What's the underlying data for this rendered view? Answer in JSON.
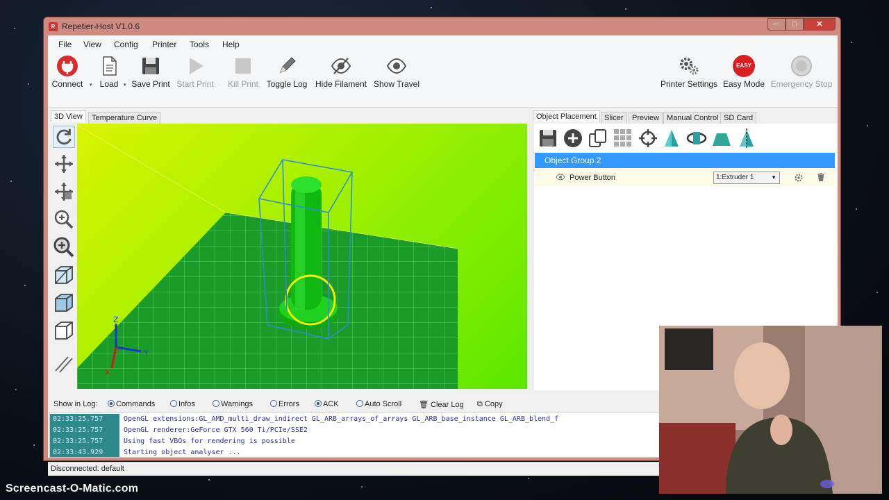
{
  "window": {
    "title": "Repetier-Host V1.0.6",
    "min_glyph": "─",
    "max_glyph": "□",
    "close_glyph": "✕",
    "icon_letter": "R"
  },
  "menu": [
    "File",
    "View",
    "Config",
    "Printer",
    "Tools",
    "Help"
  ],
  "toolbar": {
    "connect": "Connect",
    "load": "Load",
    "save_print": "Save Print",
    "start_print": "Start Print",
    "kill_print": "Kill Print",
    "toggle_log": "Toggle Log",
    "hide_filament": "Hide Filament",
    "show_travel": "Show Travel",
    "printer_settings": "Printer Settings",
    "easy_mode": "Easy Mode",
    "easy_badge": "EASY",
    "emergency_stop": "Emergency Stop",
    "dropdown_glyph": "▾"
  },
  "left_tabs": [
    "3D View",
    "Temperature Curve"
  ],
  "right_tabs": [
    "Object Placement",
    "Slicer",
    "Preview",
    "Manual Control",
    "SD Card"
  ],
  "scene": {
    "axis_z": "Z",
    "axis_y": "Y",
    "axis_x": "X"
  },
  "objects": {
    "group": "Object Group 2",
    "item": "Power Button",
    "extruder": "1:Extruder 1"
  },
  "log": {
    "show_in_log": "Show in Log:",
    "options": [
      {
        "label": "Commands",
        "checked": true
      },
      {
        "label": "Infos",
        "checked": false
      },
      {
        "label": "Warnings",
        "checked": false
      },
      {
        "label": "Errors",
        "checked": false
      },
      {
        "label": "ACK",
        "checked": true
      },
      {
        "label": "Auto Scroll",
        "checked": false
      }
    ],
    "clear_log": "Clear Log",
    "copy": "Copy",
    "entries": [
      {
        "time": "02:33:25.757",
        "message": "OpenGL extensions:GL_AMD_multi_draw_indirect GL_ARB_arrays_of_arrays GL_ARB_base_instance GL_ARB_blend_f"
      },
      {
        "time": "02:33:25.757",
        "message": "OpenGL renderer:GeForce GTX 560 Ti/PCIe/SSE2"
      },
      {
        "time": "02:33:25.757",
        "message": "Using fast VBOs for rendering is possible"
      },
      {
        "time": "02:33:43.929",
        "message": "Starting object analyser ..."
      }
    ]
  },
  "status": {
    "text": "Disconnected: default"
  },
  "watermark": "Screencast-O-Matic.com"
}
